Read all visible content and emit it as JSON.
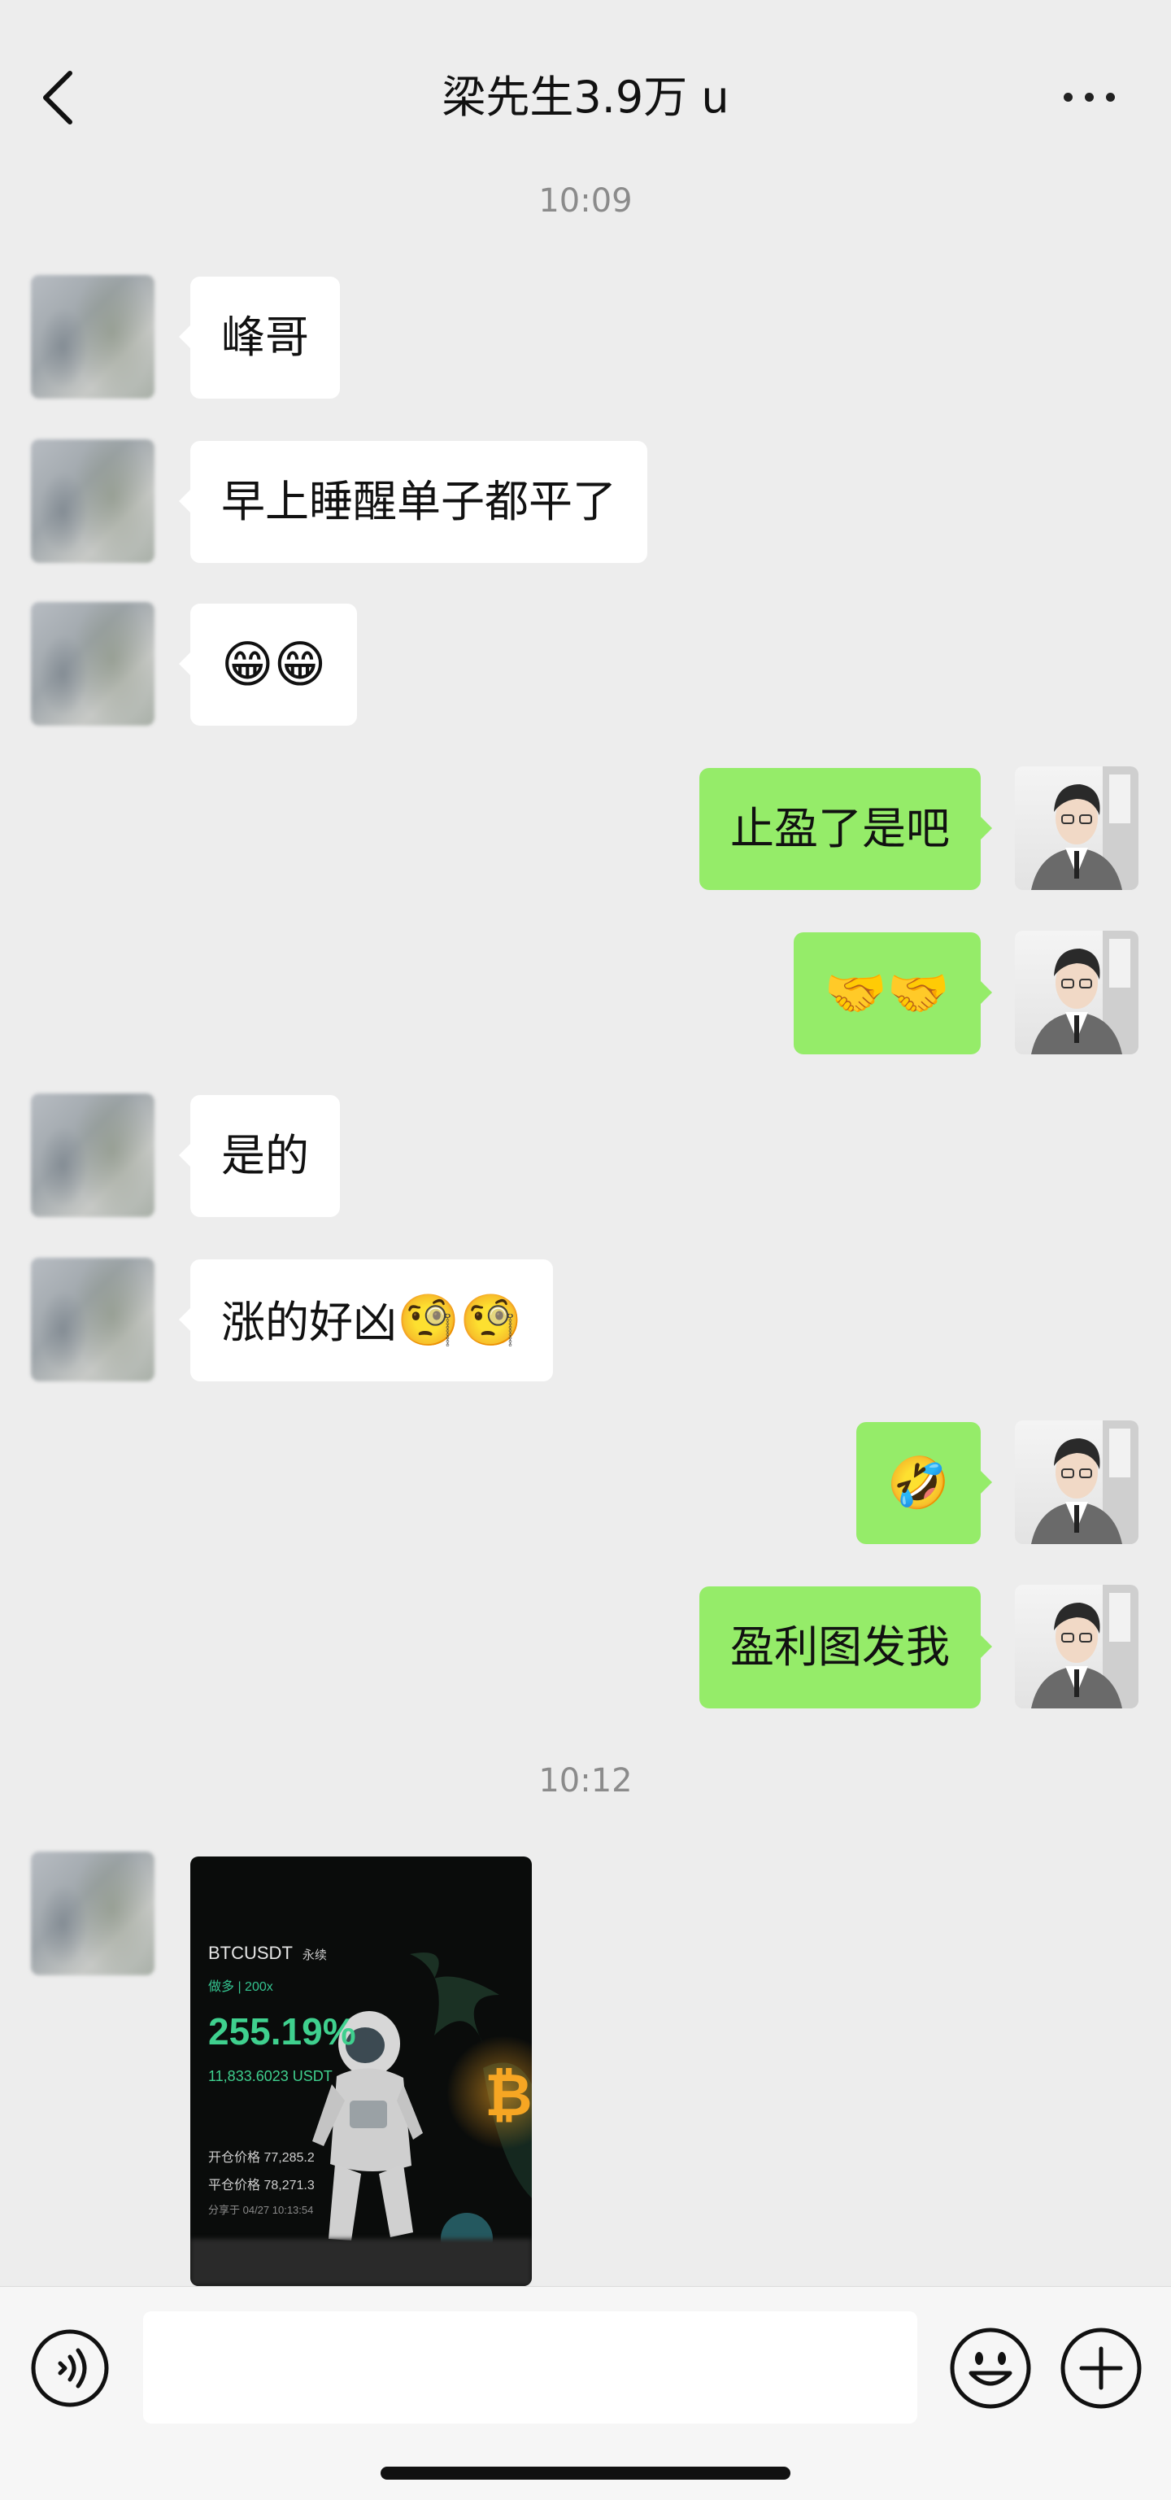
{
  "header": {
    "title": "梁先生3.9万 u"
  },
  "messages": {
    "time1": "10:09",
    "m1": "峰哥",
    "m2": "早上睡醒单子都平了",
    "m3": "😁😁",
    "m4": "止盈了是吧",
    "m5": "🤝🤝",
    "m6": "是的",
    "m7": "涨的好凶",
    "m7_emoji": "🧐🧐",
    "m8": "🤣",
    "m9": "盈利图发我",
    "time2": "10:12"
  },
  "image_card": {
    "pair": "BTCUSDT",
    "perpetual": "永续",
    "side_leverage": "做多 | 200x",
    "percent": "255.19%",
    "usdt": "11,833.6023 USDT",
    "open_price": "开仓价格 77,285.2",
    "close_price": "平仓价格 78,271.3",
    "share_time": "分享于 04/27 10:13:54"
  },
  "input_bar": {
    "placeholder": ""
  },
  "icons": {
    "back": "chevron-left-icon",
    "more": "more-dots-icon",
    "voice": "voice-icon",
    "emoji": "emoji-icon",
    "plus": "plus-icon"
  }
}
